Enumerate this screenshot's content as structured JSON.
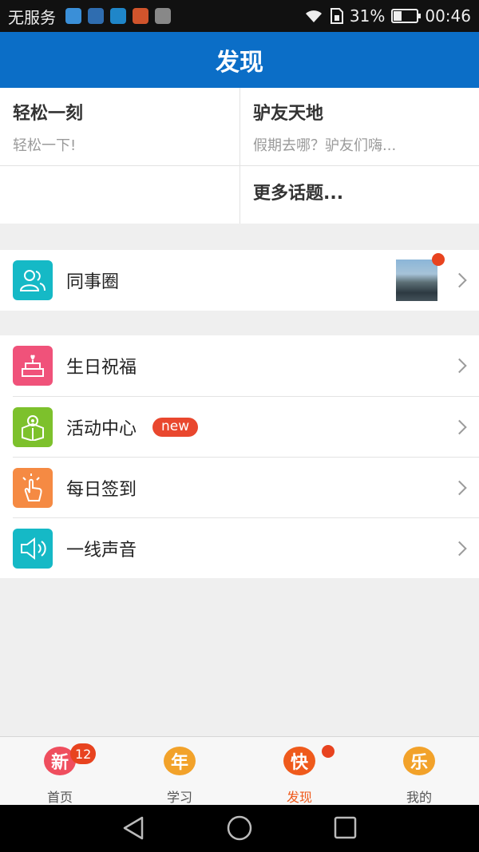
{
  "status_bar": {
    "carrier": "无服务",
    "battery_percent": "31%",
    "battery_level": 0.31,
    "time": "00:46",
    "icons": [
      "app-icon",
      "pulse-icon",
      "usb-icon",
      "app-icon",
      "image-icon",
      "wifi-icon",
      "sim-icon",
      "battery-icon"
    ]
  },
  "header": {
    "title": "发现"
  },
  "topics": [
    {
      "title": "轻松一刻",
      "subtitle": "轻松一下!"
    },
    {
      "title": "驴友天地",
      "subtitle": "假期去哪？驴友们嗨..."
    },
    {
      "title": "",
      "subtitle": ""
    },
    {
      "title": "更多话题...",
      "subtitle": ""
    }
  ],
  "moments": {
    "label": "同事圈",
    "icon": "colleagues-icon",
    "has_new": true
  },
  "menu": [
    {
      "label": "生日祝福",
      "icon": "birthday-cake-icon",
      "color": "#f0527a"
    },
    {
      "label": "活动中心",
      "icon": "activity-icon",
      "color": "#7dc12c",
      "badge": "new"
    },
    {
      "label": "每日签到",
      "icon": "tap-hand-icon",
      "color": "#f58a43"
    },
    {
      "label": "一线声音",
      "icon": "speaker-icon",
      "color": "#15b9c6"
    }
  ],
  "tabs": [
    {
      "label": "首页",
      "char": "新",
      "badge": "12",
      "color": "#ef4e5e"
    },
    {
      "label": "学习",
      "char": "年",
      "color": "#f2a22a"
    },
    {
      "label": "发现",
      "char": "快",
      "color": "#ef5a1c",
      "active": true,
      "dot": true
    },
    {
      "label": "我的",
      "char": "乐",
      "color": "#f2a22a"
    }
  ],
  "colors": {
    "accent": "#0b6ec7",
    "badge_red": "#e8431f",
    "active_tab": "#ef5a1c"
  }
}
